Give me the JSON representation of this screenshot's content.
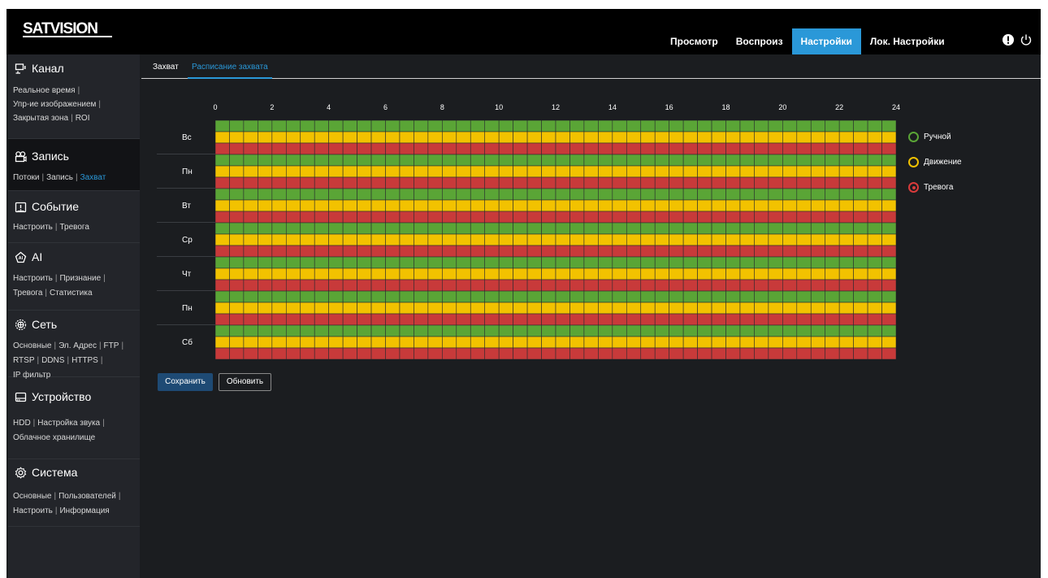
{
  "header": {
    "logo_text": "SATVISION",
    "nav": [
      "Просмотр",
      "Воспроиз",
      "Настройки",
      "Лок. Настройки"
    ],
    "nav_active": "Настройки",
    "icons": [
      "alert-icon",
      "power-icon"
    ]
  },
  "sidebar": {
    "sections": [
      {
        "title": "Канал",
        "icon": "channel-icon",
        "active": false,
        "lines": [
          [
            "Реальное время"
          ],
          [
            "Упр-ие изображением"
          ],
          [
            "Закрытая зона",
            "ROI"
          ]
        ]
      },
      {
        "title": "Запись",
        "icon": "record-icon",
        "active": true,
        "lines": [
          [
            "Потоки",
            "Запись",
            "Захват"
          ]
        ],
        "current": "Захват"
      },
      {
        "title": "Событие",
        "icon": "event-icon",
        "active": false,
        "lines": [
          [
            "Настроить",
            "Тревога"
          ]
        ]
      },
      {
        "title": "AI",
        "icon": "ai-icon",
        "active": false,
        "lines": [
          [
            "Настроить",
            "Признание"
          ],
          [
            "Тревога",
            "Статистика"
          ]
        ]
      },
      {
        "title": "Сеть",
        "icon": "network-icon",
        "active": false,
        "lines": [
          [
            "Основные",
            "Эл. Адрес",
            "FTP"
          ],
          [
            "RTSP",
            "DDNS",
            "HTTPS"
          ],
          [
            "IP фильтр"
          ]
        ]
      },
      {
        "title": "Устройство",
        "icon": "device-icon",
        "active": false,
        "lines": [
          [
            "HDD",
            "Настройка звука"
          ],
          [
            "Облачное хранилище"
          ]
        ]
      },
      {
        "title": "Система",
        "icon": "system-icon",
        "active": false,
        "lines": [
          [
            "Основные",
            "Пользователей"
          ],
          [
            "Настроить",
            "Информация"
          ]
        ]
      }
    ]
  },
  "tabs": {
    "capture": "Захват",
    "schedule": "Расписание захвата",
    "active": "Расписание захвата"
  },
  "schedule": {
    "hour_labels": [
      "0",
      "2",
      "4",
      "6",
      "8",
      "10",
      "12",
      "14",
      "16",
      "18",
      "20",
      "22",
      "24"
    ],
    "days": [
      "Вс",
      "Пн",
      "Вт",
      "Ср",
      "Чт",
      "Пн",
      "Сб"
    ],
    "hours_per_day": 24,
    "rows": [
      {
        "mode": "Ручной",
        "color": "#5aa536",
        "enabled_hours": "all"
      },
      {
        "mode": "Движение",
        "color": "#f2c200",
        "enabled_hours": "all"
      },
      {
        "mode": "Тревога",
        "color": "#c83a3a",
        "enabled_hours": "all"
      }
    ]
  },
  "legend": [
    {
      "label": "Ручной",
      "color": "#5aa536",
      "selected": false
    },
    {
      "label": "Движение",
      "color": "#f2c200",
      "selected": false
    },
    {
      "label": "Тревога",
      "color": "#d93b3b",
      "selected": true
    }
  ],
  "buttons": {
    "save": "Сохранить",
    "refresh": "Обновить"
  },
  "colors": {
    "accent": "#2a98d8",
    "save_bg": "#1e4a74"
  }
}
